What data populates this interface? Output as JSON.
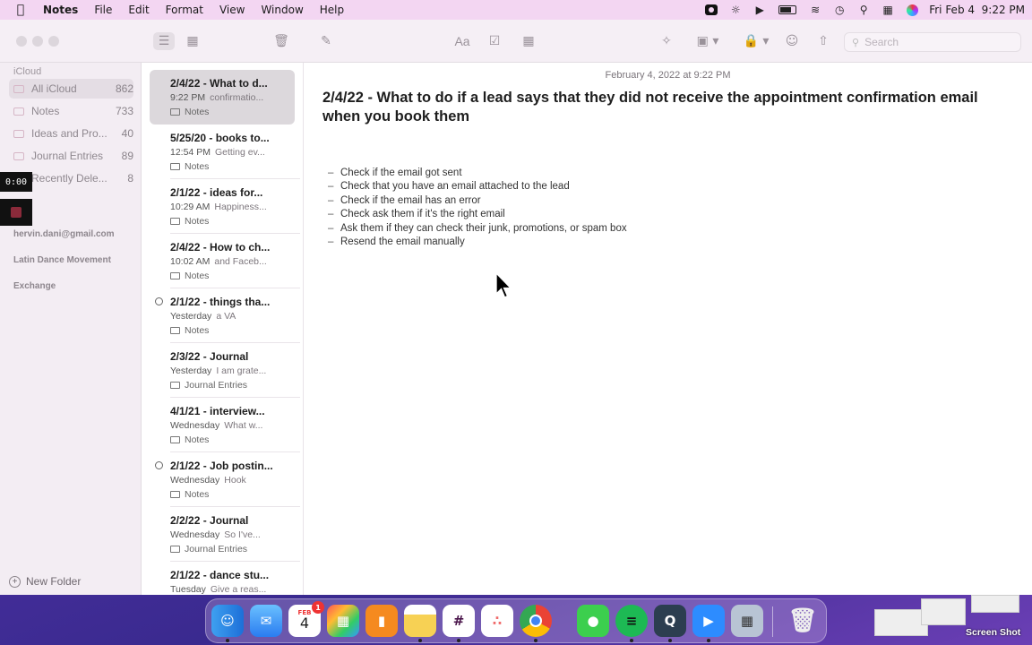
{
  "menubar": {
    "app": "Notes",
    "items": [
      "File",
      "Edit",
      "Format",
      "View",
      "Window",
      "Help"
    ],
    "datetime": "Fri Feb 4  9:22 PM"
  },
  "toolbar": {
    "search_placeholder": "Search",
    "font_label": "Aa"
  },
  "sidebar": {
    "section": "iCloud",
    "folders": [
      {
        "name": "All iCloud",
        "count": "862"
      },
      {
        "name": "Notes",
        "count": "733"
      },
      {
        "name": "Ideas and Pro...",
        "count": "40"
      },
      {
        "name": "Journal Entries",
        "count": "89"
      },
      {
        "name": "Recently Dele...",
        "count": "8"
      }
    ],
    "accounts": [
      "hervin.dani@gmail.com",
      "Latin Dance Movement",
      "Exchange"
    ],
    "new_folder": "New Folder"
  },
  "recorder": {
    "time": "0:00"
  },
  "notes": [
    {
      "title": "2/4/22 - What to d...",
      "time": "9:22 PM",
      "preview": "confirmatio...",
      "folder": "Notes"
    },
    {
      "title": "5/25/20 - books to...",
      "time": "12:54 PM",
      "preview": "Getting ev...",
      "folder": "Notes"
    },
    {
      "title": "2/1/22 - ideas for...",
      "time": "10:29 AM",
      "preview": "Happiness...",
      "folder": "Notes"
    },
    {
      "title": "2/4/22 - How to ch...",
      "time": "10:02 AM",
      "preview": "and Faceb...",
      "folder": "Notes"
    },
    {
      "title": "2/1/22 - things tha...",
      "time": "Yesterday",
      "preview": "a VA",
      "folder": "Notes"
    },
    {
      "title": "2/3/22 - Journal",
      "time": "Yesterday",
      "preview": "I am grate...",
      "folder": "Journal Entries"
    },
    {
      "title": "4/1/21 - interview...",
      "time": "Wednesday",
      "preview": "What w...",
      "folder": "Notes"
    },
    {
      "title": "2/1/22 - Job postin...",
      "time": "Wednesday",
      "preview": "Hook",
      "folder": "Notes"
    },
    {
      "title": "2/2/22 - Journal",
      "time": "Wednesday",
      "preview": "So I've...",
      "folder": "Journal Entries"
    },
    {
      "title": "2/1/22 - dance stu...",
      "time": "Tuesday",
      "preview": "Give a reas...",
      "folder": ""
    }
  ],
  "editor": {
    "date": "February 4, 2022 at 9:22 PM",
    "title": "2/4/22 - What to do if a lead says that they did not receive the appointment confirmation email when you book them",
    "items": [
      "Check if the email got sent",
      "Check that you have an email attached to the lead",
      "Check if the email has an error",
      "Check ask them if it's the right email",
      "Ask them if they can check their junk, promotions, or spam box",
      "Resend the email manually"
    ]
  },
  "dock": {
    "calendar_month": "FEB",
    "calendar_day": "4",
    "calendar_badge": "1"
  },
  "screenshot_label": "Screen Shot"
}
